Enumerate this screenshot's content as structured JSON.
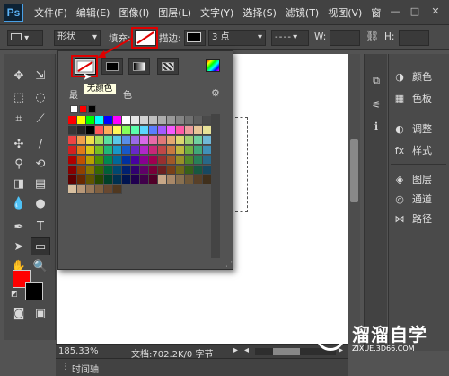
{
  "app": {
    "logo": "Ps"
  },
  "menu": [
    "文件(F)",
    "编辑(E)",
    "图像(I)",
    "图层(L)",
    "文字(Y)",
    "选择(S)",
    "滤镜(T)",
    "视图(V)",
    "窗"
  ],
  "window_controls": {
    "minimize": "—",
    "maximize": "□",
    "close": "✕"
  },
  "options_bar": {
    "shape_mode": "形状",
    "fill_label": "填充:",
    "stroke_label": "描边:",
    "stroke_width": "3 点",
    "w_label": "W:",
    "h_label": "H:"
  },
  "tools": [
    "move-icon",
    "marquee-icon",
    "lasso-icon",
    "quick-select-icon",
    "crop-icon",
    "eyedropper-icon",
    "healing-icon",
    "brush-icon",
    "stamp-icon",
    "history-brush-icon",
    "eraser-icon",
    "gradient-icon",
    "blur-icon",
    "dodge-icon",
    "pen-icon",
    "type-icon",
    "path-select-icon",
    "shape-icon",
    "hand-icon",
    "zoom-icon"
  ],
  "colors": {
    "foreground": "#ff0000",
    "background": "#000000",
    "accent_red": "#e00000"
  },
  "fill_popup": {
    "recent_label": "最",
    "recent_label_tail": "色",
    "tooltip": "无颜色",
    "recent_colors": [
      "#ffffff",
      "#ff0000",
      "#000000"
    ]
  },
  "swatches": [
    [
      "#ff0000",
      "#ffff00",
      "#00ff00",
      "#00ffff",
      "#0000ff",
      "#ff00ff",
      "#ffffff",
      "#e6e6e6",
      "#d3d3d3",
      "#c0c0c0",
      "#adadad",
      "#999999",
      "#858585",
      "#717171",
      "#5e5e5e",
      "#4a4a4a"
    ],
    [
      "#363636",
      "#232323",
      "#000000",
      "#ff5a5a",
      "#ffab5a",
      "#fff65a",
      "#86ff5a",
      "#5affad",
      "#5ad7ff",
      "#5a7eff",
      "#a35aff",
      "#f65aff",
      "#ff5aa8",
      "#ec9c9c",
      "#e8c598",
      "#e8e298"
    ],
    [
      "#ee4444",
      "#f0a04c",
      "#f0e04c",
      "#a8e05a",
      "#5ae0a0",
      "#5ac8e8",
      "#5a8ee8",
      "#9a6ae8",
      "#d86ae8",
      "#e86aa8",
      "#e07878",
      "#e4a870",
      "#dcd870",
      "#9cd070",
      "#70d0a0",
      "#70b8d8"
    ],
    [
      "#d42020",
      "#e07a18",
      "#d8c818",
      "#78c020",
      "#20b878",
      "#1898c8",
      "#1858c8",
      "#6828c8",
      "#b028c8",
      "#c82878",
      "#c04848",
      "#c87840",
      "#c0b840",
      "#70b040",
      "#40a878",
      "#4090b8"
    ],
    [
      "#b00000",
      "#c05000",
      "#b8a000",
      "#509000",
      "#008850",
      "#006898",
      "#0030a0",
      "#4800a0",
      "#880090",
      "#a00050",
      "#983030",
      "#a05828",
      "#988f28",
      "#508828",
      "#288058",
      "#286888"
    ],
    [
      "#880000",
      "#904000",
      "#887800",
      "#386800",
      "#006038",
      "#004870",
      "#002070",
      "#300070",
      "#600068",
      "#780038",
      "#6c2020",
      "#784018",
      "#706818",
      "#386018",
      "#185840",
      "#184860"
    ],
    [
      "#600000",
      "#682800",
      "#605400",
      "#284800",
      "#004028",
      "#003050",
      "#001450",
      "#200050",
      "#40004a",
      "#500028",
      "#c8a888",
      "#a88868",
      "#887050",
      "#705838",
      "#584028",
      "#40301c"
    ],
    [
      "#d8c0a0",
      "#b89878",
      "#987858",
      "#806040",
      "#684830",
      "#503820"
    ]
  ],
  "status": {
    "zoom": "185.33%",
    "doc_info": "文档:702.2K/0 字节",
    "timeline_tab": "时间轴"
  },
  "panels_top": [
    {
      "icon": "color-icon",
      "label": "颜色"
    },
    {
      "icon": "swatches-icon",
      "label": "色板"
    }
  ],
  "panels_mid": [
    {
      "icon": "adjustments-icon",
      "label": "调整"
    },
    {
      "icon": "styles-icon",
      "label": "样式"
    }
  ],
  "panels_bottom": [
    {
      "icon": "layers-icon",
      "label": "图层"
    },
    {
      "icon": "channels-icon",
      "label": "通道"
    },
    {
      "icon": "paths-icon",
      "label": "路径"
    }
  ],
  "watermark": {
    "brand": "溜溜自学",
    "url": "ZIXUE.3D66.COM"
  }
}
